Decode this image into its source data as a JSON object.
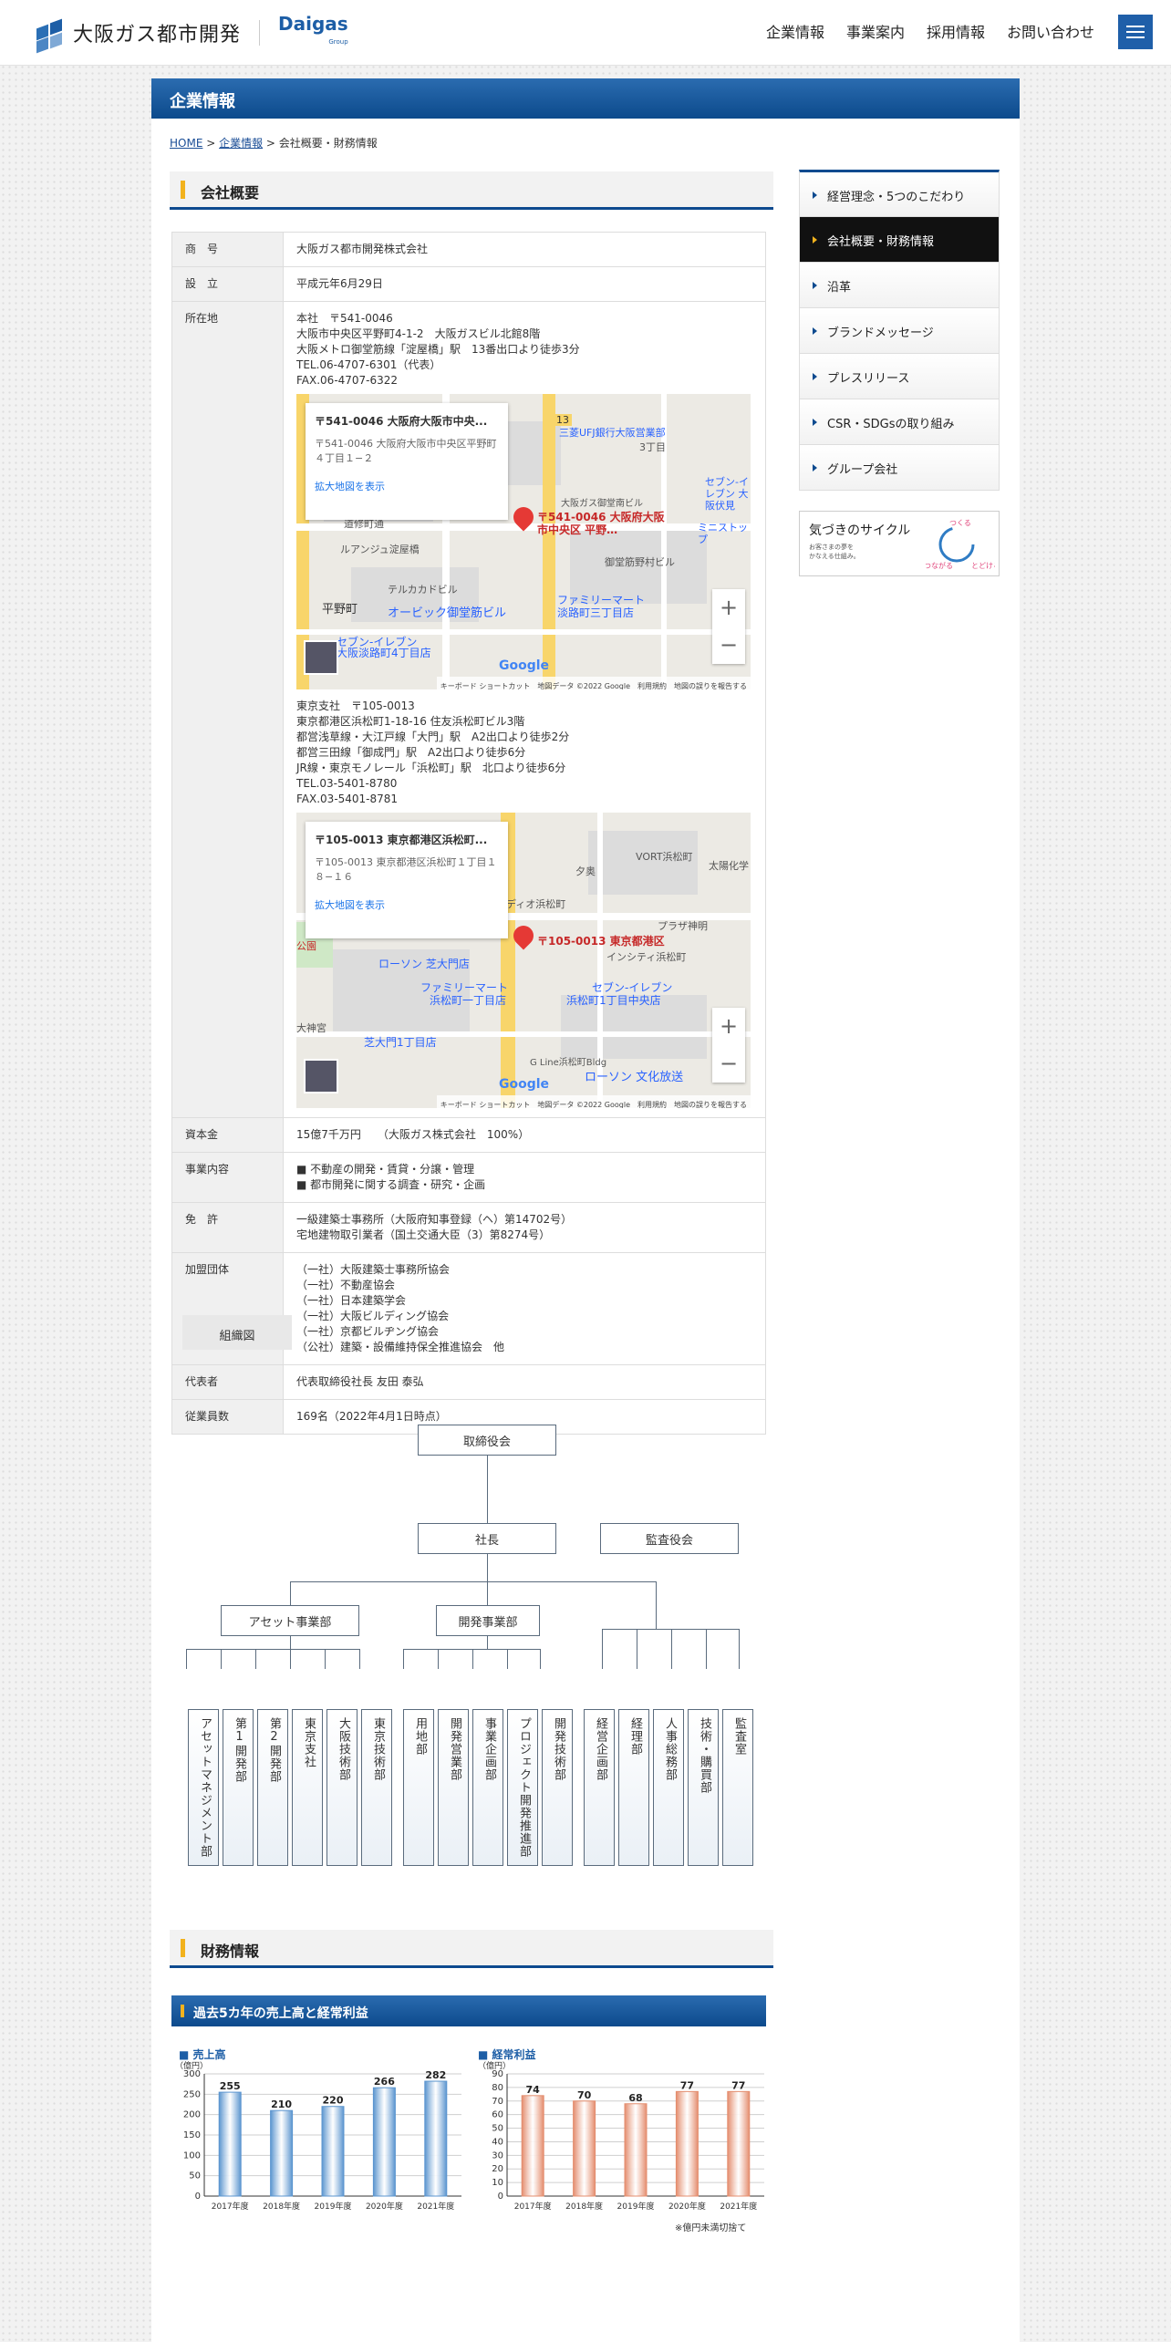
{
  "header": {
    "logo_text": "大阪ガス都市開発",
    "logo_brand": "Daigas",
    "logo_brand_sub": "Group",
    "nav": [
      "企業情報",
      "事業案内",
      "採用情報",
      "お問い合わせ"
    ]
  },
  "page": {
    "title": "企業情報",
    "breadcrumb": {
      "home": "HOME",
      "corp": "企業情報",
      "current": "会社概要・財務情報",
      "sep": " > "
    }
  },
  "overview": {
    "heading": "会社概要",
    "rows": [
      {
        "k": "商　号",
        "v": [
          "大阪ガス都市開発株式会社"
        ]
      },
      {
        "k": "設　立",
        "v": [
          "平成元年6月29日"
        ]
      }
    ],
    "address_key": "所在地",
    "hq": [
      "本社　〒541-0046",
      "大阪市中央区平野町4-1-2　大阪ガスビル北館8階",
      "大阪メトロ御堂筋線「淀屋橋」駅　13番出口より徒歩3分",
      "TEL.06-4707-6301（代表）",
      "FAX.06-4707-6322"
    ],
    "hq_map": {
      "title": "〒541-0046 大阪府大阪市中央...",
      "addr": "〒541-0046 大阪府大阪市中央区平野町４丁目１−２",
      "link": "拡大地図を表示",
      "pin": "〒541-0046 大阪府大阪市中央区 平野…",
      "footer": "キーボード ショートカット　地図データ ©2022 Google　利用規約　地図の誤りを報告する",
      "labels": [
        "三菱UFJ銀行大阪営業部",
        "3丁目",
        "大阪ガス御堂南ビル",
        "道修町通",
        "ルアンジュ淀屋橋",
        "御堂筋野村ビル",
        "テルカカドビル",
        "平野町",
        "オービック御堂筋ビル",
        "ファミリーマート",
        "淡路町三丁目店",
        "セブン-イレブン",
        "大阪淡路町4丁目店",
        "ミニストップ",
        "セブン-イレブン 大阪伏見",
        "13"
      ]
    },
    "branch": [
      "東京支社　〒105-0013",
      "東京都港区浜松町1-18-16 住友浜松町ビル3階",
      "都営浅草線・大江戸線「大門」駅　A2出口より徒歩2分",
      "都営三田線「御成門」駅　A2出口より徒歩6分",
      "JR線・東京モノレール「浜松町」駅　北口より徒歩6分",
      "TEL.03-5401-8780",
      "FAX.03-5401-8781"
    ],
    "branch_map": {
      "title": "〒105-0013 東京都港区浜松町...",
      "addr": "〒105-0013 東京都港区浜松町１丁目１８−１６",
      "link": "拡大地図を表示",
      "pin": "〒105-0013 東京都港区",
      "footer": "キーボード ショートカット　地図データ ©2022 Google　利用規約　地図の誤りを報告する",
      "labels": [
        "VORT浜松町",
        "プラザ神明",
        "インシティ浜松町",
        "ローソン 芝大門店",
        "ファミリーマート",
        "浜松町一丁目店",
        "セブン-イレブン",
        "浜松町1丁目中央店",
        "芝大門1丁目店",
        "大神宮",
        "公園",
        "G Line浜松町Bldg",
        "ローソン 文化放送",
        "太陽化学",
        "夕奥",
        "ディオ浜松町"
      ]
    },
    "rows2": [
      {
        "k": "資本金",
        "v": [
          "15億7千万円　　（大阪ガス株式会社　100%）"
        ]
      },
      {
        "k": "事業内容",
        "v": [
          "■ 不動産の開発・賃貸・分譲・管理",
          "■ 都市開発に関する調査・研究・企画"
        ]
      },
      {
        "k": "免　許",
        "v": [
          "一級建築士事務所（大阪府知事登録（ヘ）第14702号）",
          "宅地建物取引業者（国土交通大臣（3）第8274号）"
        ]
      },
      {
        "k": "加盟団体",
        "v": [
          "（一社）大阪建築士事務所協会",
          "（一社）不動産協会",
          "（一社）日本建築学会",
          "（一社）大阪ビルディング協会",
          "（一社）京都ビルヂング協会",
          "（公社）建築・設備維持保全推進協会　他"
        ]
      },
      {
        "k": "代表者",
        "v": [
          "代表取締役社長 友田 泰弘"
        ]
      },
      {
        "k": "従業員数",
        "v": [
          "169名（2022年4月1日時点）"
        ]
      }
    ]
  },
  "org": {
    "label": "組織図",
    "board": "取締役会",
    "president": "社長",
    "auditor": "監査役会",
    "div1": "アセット事業部",
    "div2": "開発事業部",
    "g1": [
      "アセットマネジメント部",
      "第1開発部",
      "第2開発部",
      "東京支社",
      "大阪技術部",
      "東京技術部"
    ],
    "g2": [
      "用地部",
      "開発営業部",
      "事業企画部",
      "プロジェクト開発推進部",
      "開発技術部"
    ],
    "g3": [
      "経営企画部",
      "経理部",
      "人事総務部",
      "技術・購買部",
      "監査室"
    ]
  },
  "sidebar": {
    "items": [
      "経営理念・5つのこだわり",
      "会社概要・財務情報",
      "沿革",
      "ブランドメッセージ",
      "プレスリリース",
      "CSR・SDGsの取り組み",
      "グループ会社"
    ],
    "banner_title": "気づきのサイクル",
    "banner_sub1": "お客さまの夢を",
    "banner_sub2": "かなえる仕組み。",
    "banner_words": [
      "つくる",
      "つながる",
      "とどける"
    ]
  },
  "finance": {
    "heading": "財務情報",
    "chart_heading": "過去5カ年の売上高と経常利益",
    "note": "※億円未満切捨て"
  },
  "chart_data": [
    {
      "type": "bar",
      "title": "■ 売上高",
      "ylabel": "（億円）",
      "categories": [
        "2017年度",
        "2018年度",
        "2019年度",
        "2020年度",
        "2021年度"
      ],
      "values": [
        255,
        210,
        220,
        266,
        282
      ],
      "ylim": [
        0,
        300
      ],
      "yticks": [
        0,
        50,
        100,
        150,
        200,
        250,
        300
      ],
      "color": "#5b95cf"
    },
    {
      "type": "bar",
      "title": "■ 経常利益",
      "ylabel": "（億円）",
      "categories": [
        "2017年度",
        "2018年度",
        "2019年度",
        "2020年度",
        "2021年度"
      ],
      "values": [
        74,
        70,
        68,
        77,
        77
      ],
      "ylim": [
        0,
        90
      ],
      "yticks": [
        0,
        10,
        20,
        30,
        40,
        50,
        60,
        70,
        80,
        90
      ],
      "color": "#e48d6e"
    }
  ]
}
